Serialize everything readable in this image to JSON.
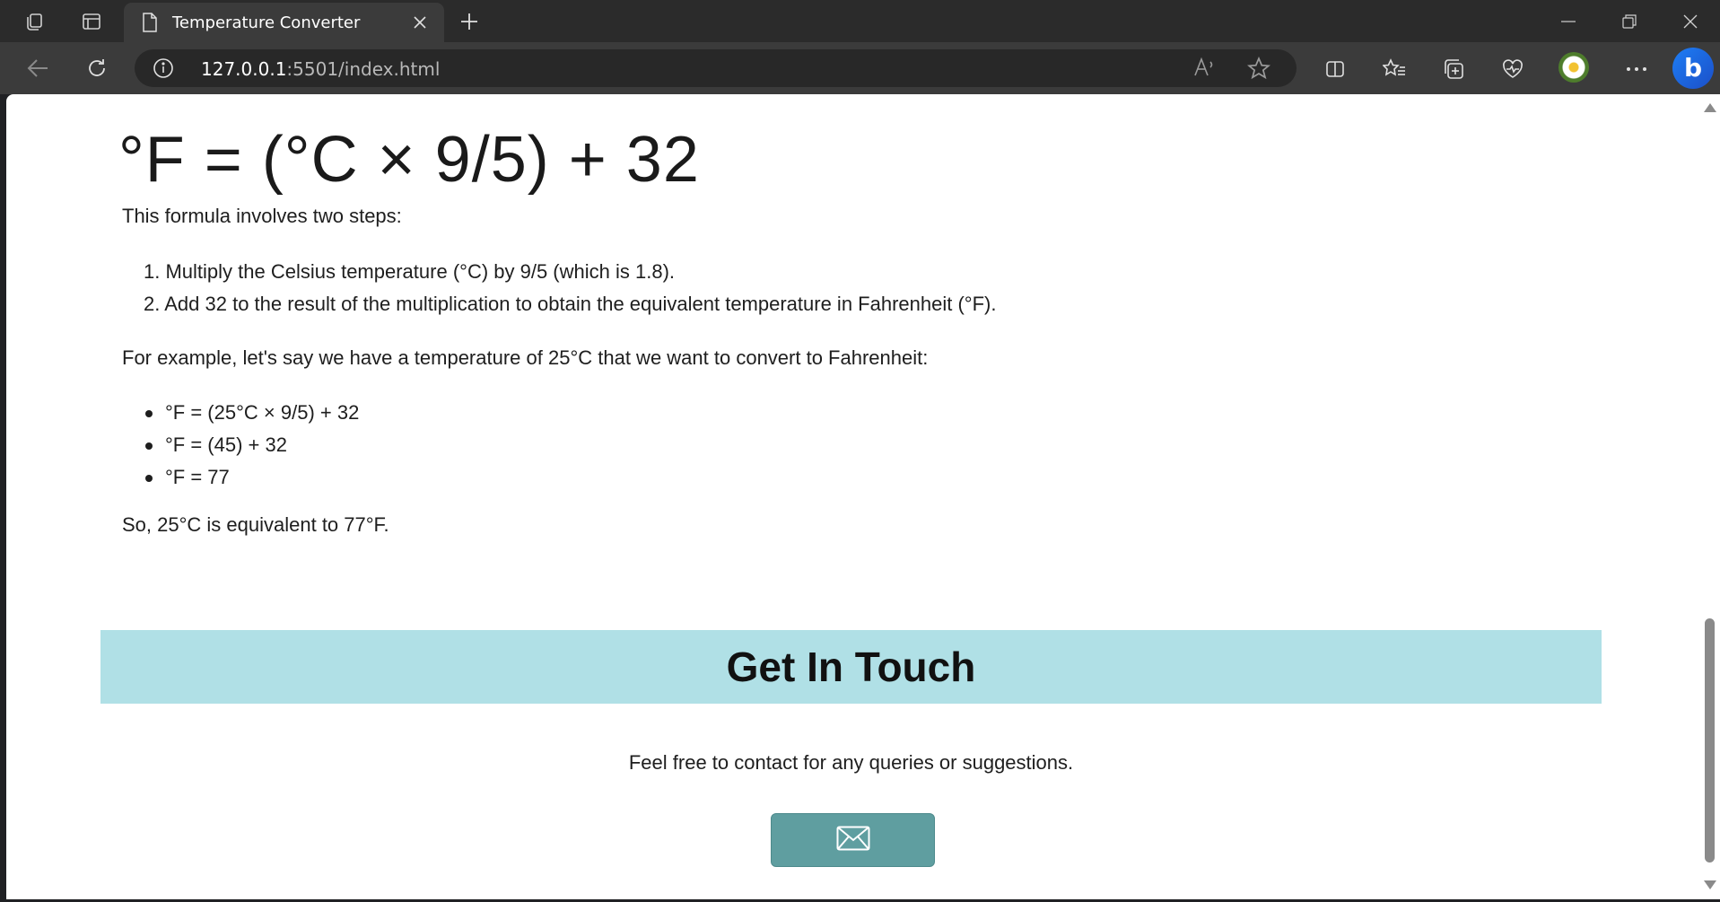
{
  "browser": {
    "tab": {
      "title": "Temperature Converter",
      "icon": "page-icon"
    },
    "address": {
      "host": "127.0.0.1",
      "rest": ":5501/index.html"
    },
    "icons": [
      "workspaces-icon",
      "tab-actions-icon",
      "close-icon",
      "plus-icon",
      "minimize-icon",
      "restore-icon",
      "window-close-icon",
      "back-icon",
      "refresh-icon",
      "info-icon",
      "read-aloud-icon",
      "favorite-star-icon",
      "split-screen-icon",
      "favorites-icon",
      "collections-icon",
      "browser-essentials-icon",
      "more-icon",
      "copilot-icon"
    ],
    "colors": {
      "frame": "#2b2b2b",
      "toolbar": "#3b3b3b",
      "address_bg": "#282828"
    }
  },
  "article": {
    "formula": "°F = (°C × 9/5) + 32",
    "intro": "This formula involves two steps:",
    "steps": [
      "1. Multiply the Celsius temperature (°C) by 9/5 (which is 1.8).",
      "2. Add 32 to the result of the multiplication to obtain the equivalent temperature in Fahrenheit (°F)."
    ],
    "example_intro": "For example, let's say we have a temperature of 25°C that we want to convert to Fahrenheit:",
    "example_steps": [
      "°F = (25°C × 9/5) + 32",
      "°F = (45) + 32",
      "°F = 77"
    ],
    "conclusion": "So, 25°C is equivalent to 77°F."
  },
  "contact": {
    "heading": "Get In Touch",
    "text": "Feel free to contact for any queries or suggestions.",
    "button_icon": "envelope-icon",
    "colors": {
      "band": "#b0e0e6",
      "button": "#5f9ea0"
    }
  }
}
